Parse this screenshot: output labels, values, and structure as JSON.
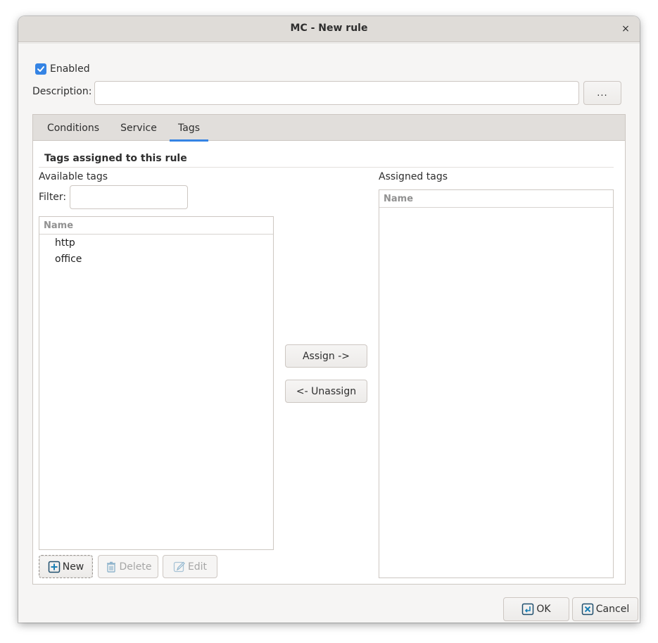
{
  "window": {
    "title": "MC - New rule",
    "close_label": "×"
  },
  "form": {
    "enabled_label": "Enabled",
    "enabled_checked": true,
    "description_label": "Description:",
    "description_value": "",
    "more_button_label": "..."
  },
  "tabs": [
    {
      "label": "Conditions",
      "active": false
    },
    {
      "label": "Service",
      "active": false
    },
    {
      "label": "Tags",
      "active": true
    }
  ],
  "tags_panel": {
    "section_title": "Tags assigned to this rule",
    "available_label": "Available tags",
    "filter_label": "Filter:",
    "filter_value": "",
    "available_column_header": "Name",
    "available_items": [
      "http",
      "office"
    ],
    "assigned_label": "Assigned tags",
    "assigned_column_header": "Name",
    "assigned_items": [],
    "assign_button": "Assign ->",
    "unassign_button": "<- Unassign",
    "new_button": "New",
    "delete_button": "Delete",
    "edit_button": "Edit"
  },
  "footer": {
    "ok_button": "OK",
    "cancel_button": "Cancel"
  },
  "colors": {
    "accent": "#3584e4",
    "icon_dark": "#1f4f6e",
    "disabled_text": "#a6a6a6"
  }
}
